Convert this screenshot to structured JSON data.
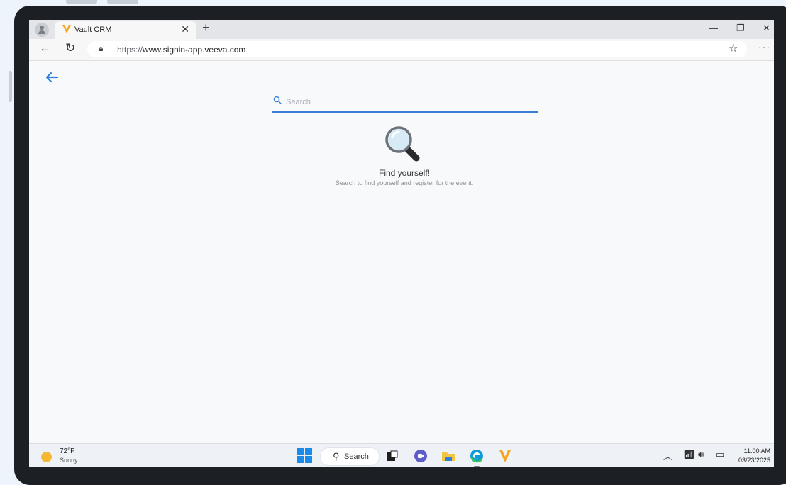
{
  "browser": {
    "tab_title": "Vault CRM",
    "url_prefix": "https://",
    "url_host": "www.signin-app.veeva.com"
  },
  "page": {
    "search_placeholder": "Search",
    "empty_title": "Find yourself!",
    "empty_subtitle": "Search to find yourself and register for the event."
  },
  "taskbar": {
    "weather_temp": "72°F",
    "weather_condition": "Sunny",
    "search_label": "Search",
    "time": "11:00 AM",
    "date": "03/23/2025"
  },
  "colors": {
    "accent": "#3d7fd0",
    "veeva_orange": "#f7a21b"
  }
}
